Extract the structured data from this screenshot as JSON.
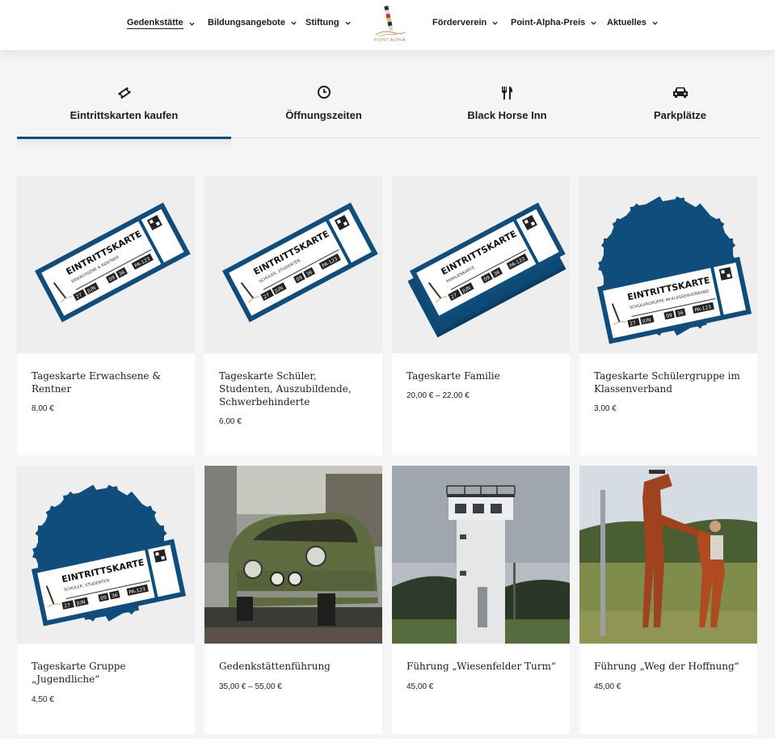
{
  "nav": {
    "items": [
      {
        "label": "Gedenkstätte"
      },
      {
        "label": "Bildungsangebote"
      },
      {
        "label": "Stiftung"
      },
      {
        "label": "Förderverein"
      },
      {
        "label": "Point-Alpha-Preis"
      },
      {
        "label": "Aktuelles"
      }
    ],
    "logo_text": "POINT ALPHA"
  },
  "tabs": [
    {
      "label": "Eintrittskarten kaufen",
      "icon": "ticket-icon"
    },
    {
      "label": "Öffnungszeiten",
      "icon": "clock-icon"
    },
    {
      "label": "Black Horse Inn",
      "icon": "cutlery-icon"
    },
    {
      "label": "Parkplätze",
      "icon": "car-icon"
    }
  ],
  "ticket": {
    "heading": "EINTRITTSKARTE",
    "day": "27",
    "month": "JUN",
    "hour": "09",
    "minute": "36",
    "code": "PA-123"
  },
  "products": [
    {
      "title": "Tageskarte Erwachsene & Rentner",
      "price": "8,00 €",
      "sub": "ERWACHSENE & RENTNER"
    },
    {
      "title": "Tageskarte Schüler, Studenten, Auszubildende, Schwerbehinderte",
      "price": "6,00 €",
      "sub": "SCHÜLER, STUDENTEN"
    },
    {
      "title": "Tageskarte Familie",
      "price": "20,00 € – 22,00 €",
      "sub": "FAMILIENKARTE"
    },
    {
      "title": "Tageskarte Schülergruppe im Klassenverband",
      "price": "3,00 €",
      "sub": "SCHÜLERGRUPPE IM KLASSENVERBAND"
    },
    {
      "title": "Tageskarte Gruppe „Jugendliche“",
      "price": "4,50 €",
      "sub": "SCHÜLER, STUDENTEN"
    },
    {
      "title": "Gedenkstättenführung",
      "price": "35,00 € – 55,00 €"
    },
    {
      "title": "Führung „Wiesenfelder Turm“",
      "price": "45,00 €"
    },
    {
      "title": "Führung „Weg der Hoffnung“",
      "price": "45,00 €"
    }
  ],
  "colors": {
    "accent": "#0d4f7e",
    "ticket_blue": "#0e4d7c"
  }
}
